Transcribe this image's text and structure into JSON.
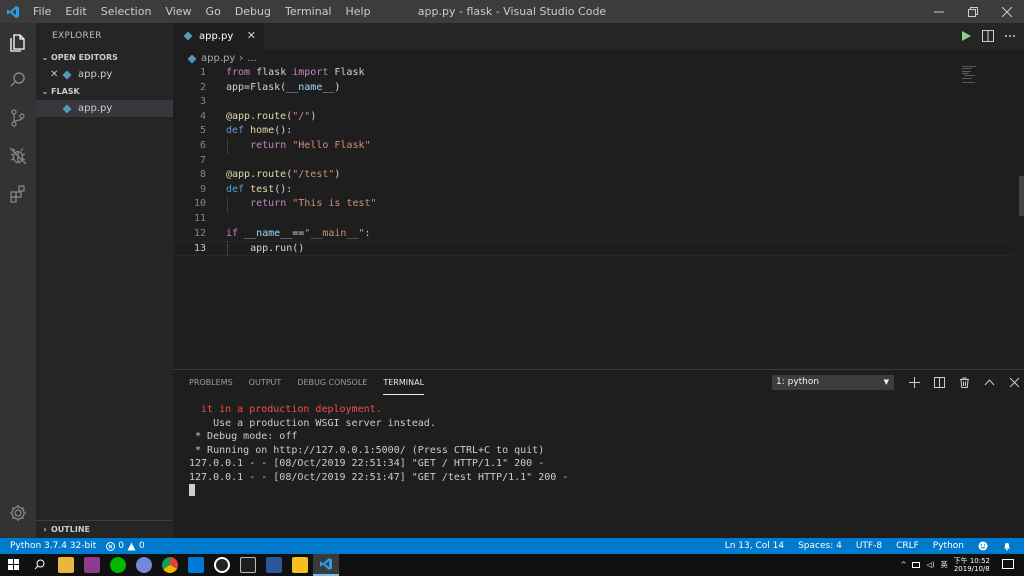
{
  "window": {
    "title": "app.py - flask - Visual Studio Code",
    "menu": [
      "File",
      "Edit",
      "Selection",
      "View",
      "Go",
      "Debug",
      "Terminal",
      "Help"
    ]
  },
  "sidebar": {
    "title": "EXPLORER",
    "open_editors_label": "OPEN EDITORS",
    "open_editors": [
      "app.py"
    ],
    "folder_label": "FLASK",
    "folder_files": [
      "app.py"
    ],
    "outline_label": "OUTLINE"
  },
  "editor": {
    "tab_label": "app.py",
    "breadcrumb_file": "app.py",
    "breadcrumb_more": "...",
    "current_line": 13,
    "lines": [
      "from flask import Flask",
      "app=Flask(__name__)",
      "",
      "@app.route(\"/\")",
      "def home():",
      "    return \"Hello Flask\"",
      "",
      "@app.route(\"/test\")",
      "def test():",
      "    return \"This is test\"",
      "",
      "if __name__==\"__main__\":",
      "    app.run()"
    ]
  },
  "panel": {
    "tabs": [
      "PROBLEMS",
      "OUTPUT",
      "DEBUG CONSOLE",
      "TERMINAL"
    ],
    "active_tab": "TERMINAL",
    "terminal_select": "1: python",
    "terminal_lines": [
      {
        "text": "  it in a production deployment.",
        "red": true
      },
      {
        "text": "    Use a production WSGI server instead.",
        "red": false
      },
      {
        "text": " * Debug mode: off",
        "red": false
      },
      {
        "text": " * Running on http://127.0.0.1:5000/ (Press CTRL+C to quit)",
        "red": false
      },
      {
        "text": "127.0.0.1 - - [08/Oct/2019 22:51:34] \"GET / HTTP/1.1\" 200 -",
        "red": false
      },
      {
        "text": "127.0.0.1 - - [08/Oct/2019 22:51:47] \"GET /test HTTP/1.1\" 200 -",
        "red": false
      }
    ]
  },
  "statusbar": {
    "python_version": "Python 3.7.4 32-bit",
    "errors": "0",
    "warnings": "0",
    "position": "Ln 13, Col 14",
    "spaces": "Spaces: 4",
    "encoding": "UTF-8",
    "eol": "CRLF",
    "language": "Python"
  },
  "taskbar": {
    "clock_time": "下午 10:52",
    "clock_date": "2019/10/8",
    "ime": "英"
  }
}
